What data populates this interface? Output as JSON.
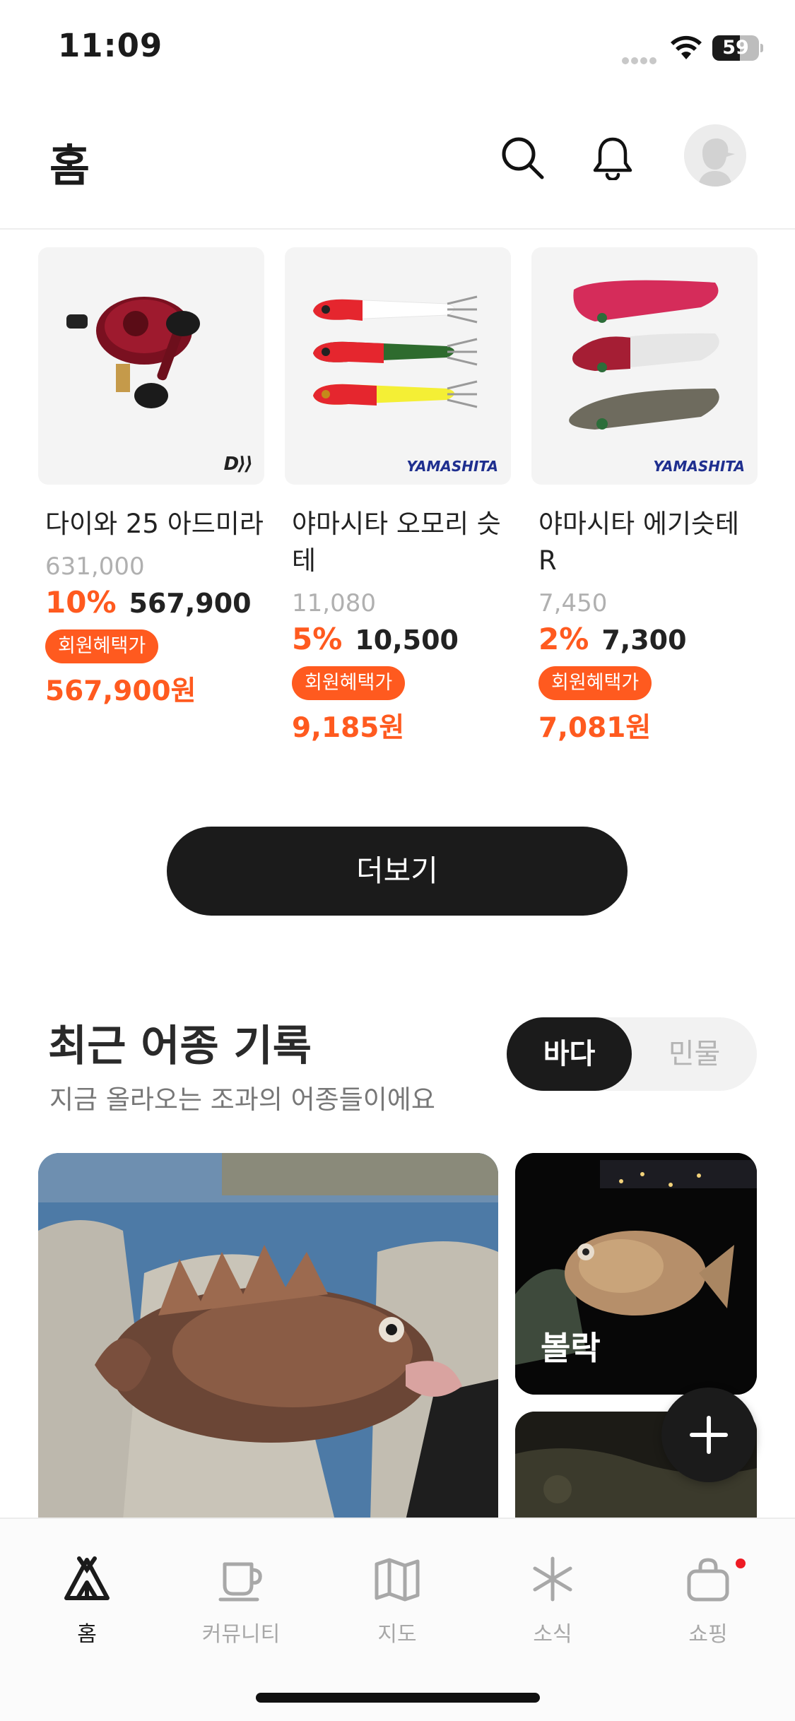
{
  "status_bar": {
    "time": "11:09",
    "battery": "59",
    "battery_level": 0.59
  },
  "header": {
    "title": "홈"
  },
  "products": [
    {
      "name": "다이와 25 아드미라",
      "brand": "DAIWA",
      "original_price": "631,000",
      "discount": "10%",
      "sale_price": "567,900",
      "member_badge": "회원혜택가",
      "member_price": "567,900원"
    },
    {
      "name": "야마시타 오모리 슷테",
      "brand": "YAMASHITA",
      "original_price": "11,080",
      "discount": "5%",
      "sale_price": "10,500",
      "member_badge": "회원혜택가",
      "member_price": "9,185원"
    },
    {
      "name": "야마시타 에기슷테 R",
      "brand": "YAMASHITA",
      "original_price": "7,450",
      "discount": "2%",
      "sale_price": "7,300",
      "member_badge": "회원혜택가",
      "member_price": "7,081원"
    }
  ],
  "more_button": "더보기",
  "recent_catch": {
    "title": "최근 어종 기록",
    "subtitle": "지금 올라오는 조과의 어종들이에요",
    "tabs": [
      "바다",
      "민물"
    ],
    "active_tab": "바다",
    "photo_labels": [
      "볼락"
    ]
  },
  "tab_bar": [
    {
      "label": "홈",
      "icon": "tent-icon",
      "active": true
    },
    {
      "label": "커뮤니티",
      "icon": "cup-icon",
      "active": false
    },
    {
      "label": "지도",
      "icon": "map-icon",
      "active": false
    },
    {
      "label": "소식",
      "icon": "asterisk-icon",
      "active": false
    },
    {
      "label": "쇼핑",
      "icon": "bag-icon",
      "active": false,
      "badge": true
    }
  ],
  "colors": {
    "accent": "#ff5a1f",
    "dark": "#1b1b1b",
    "muted": "#a8a8a8",
    "badge_red": "#ee1b24"
  }
}
